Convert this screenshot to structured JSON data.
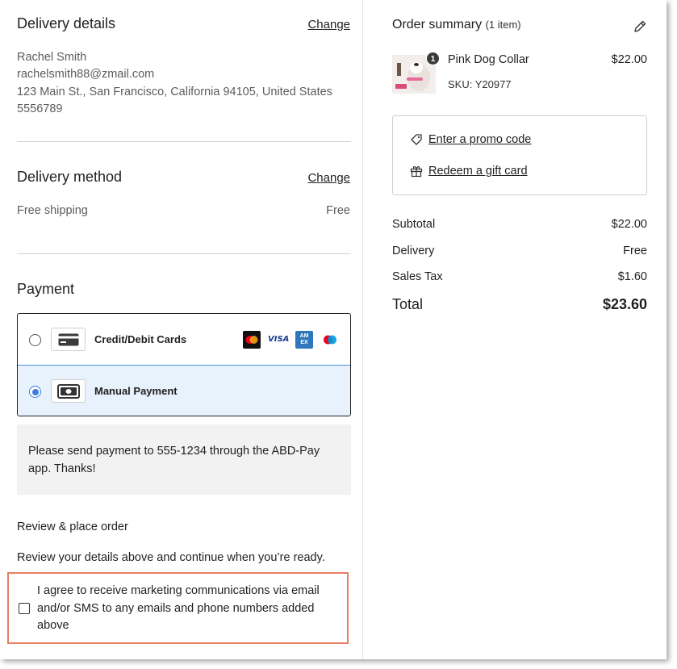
{
  "delivery_details": {
    "title": "Delivery details",
    "change_label": "Change",
    "name": "Rachel Smith",
    "email": "rachelsmith88@zmail.com",
    "address": "123 Main St., San Francisco, California 94105, United States",
    "phone": "5556789"
  },
  "delivery_method": {
    "title": "Delivery method",
    "change_label": "Change",
    "option": "Free shipping",
    "price": "Free"
  },
  "payment": {
    "title": "Payment",
    "options": [
      {
        "label": "Credit/Debit Cards",
        "selected": false,
        "icon": "credit-card-icon",
        "brands": [
          "mastercard-icon",
          "visa-icon",
          "amex-icon",
          "maestro-icon"
        ]
      },
      {
        "label": "Manual Payment",
        "selected": true,
        "icon": "cash-icon"
      }
    ],
    "note": "Please send payment to 555-1234 through the ABD-Pay app. Thanks!",
    "visa_text": "VISA",
    "amex_text": "AM EX"
  },
  "review": {
    "title": "Review & place order",
    "text": "Review your details above and continue when you’re ready.",
    "agree_text": "I agree to receive marketing communications via email and/or SMS to any emails and phone numbers added above",
    "agree_checked": false
  },
  "order_summary": {
    "title": "Order summary",
    "count": "(1 item)",
    "item": {
      "name": "Pink Dog Collar",
      "sku": "SKU: Y20977",
      "price": "$22.00",
      "quantity_badge": "1"
    },
    "promo_label": "Enter a promo code",
    "gift_label": "Redeem a gift card",
    "rows": [
      {
        "label": "Subtotal",
        "value": "$22.00"
      },
      {
        "label": "Delivery",
        "value": "Free"
      },
      {
        "label": "Sales Tax",
        "value": "$1.60"
      }
    ],
    "total_label": "Total",
    "total_value": "$23.60"
  },
  "colors": {
    "selected_bg": "#e8f2fd",
    "radio_blue": "#3b7ddd",
    "highlight_border": "#e87d62"
  }
}
